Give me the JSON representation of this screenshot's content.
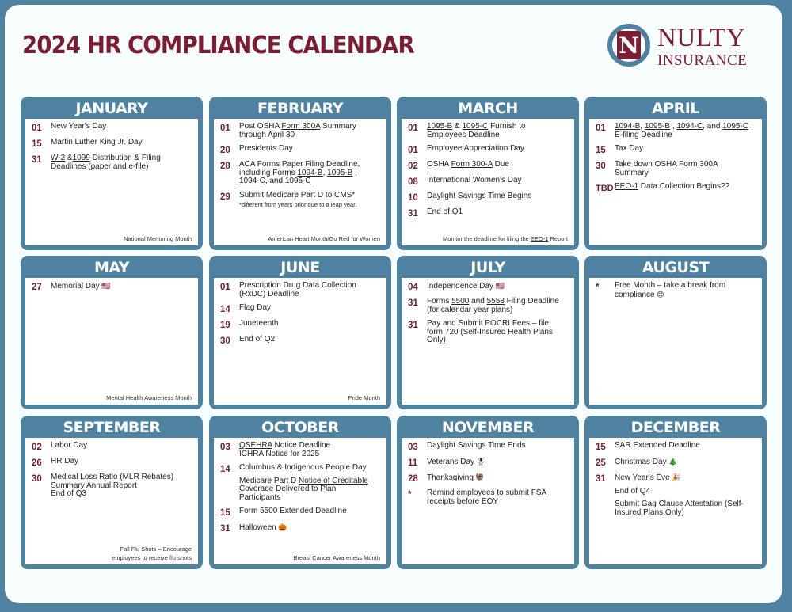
{
  "title": "2024 HR COMPLIANCE CALENDAR",
  "logo": {
    "name": "NULTY",
    "subtitle": "INSURANCE",
    "mark": "N"
  },
  "colors": {
    "brand_red": "#7a1f33",
    "brand_blue": "#4f82a0",
    "day_number": "#6b1f2e"
  },
  "months": [
    {
      "name": "JANUARY",
      "events": [
        {
          "day": "01",
          "lines": [
            "New Year's Day"
          ]
        },
        {
          "day": "15",
          "lines": [
            "Martin Luther King Jr. Day"
          ]
        },
        {
          "day": "31",
          "lines": [
            "W-2 &1099 Distribution & Filing",
            "Deadlines (paper and e-file)"
          ],
          "underlined": [
            "W-2",
            "1099"
          ]
        }
      ],
      "footer": [
        "National Mentoring Month"
      ]
    },
    {
      "name": "FEBRUARY",
      "events": [
        {
          "day": "01",
          "lines": [
            "Post OSHA Form 300A Summary",
            "through April 30"
          ],
          "underlined": [
            "Form 300A"
          ]
        },
        {
          "day": "20",
          "lines": [
            "Presidents Day"
          ]
        },
        {
          "day": "28",
          "lines": [
            "ACA Forms Paper Filing Deadline,",
            "including Forms 1094-B, 1095-B ,",
            "1094-C, and 1095-C"
          ],
          "underlined": [
            "1094-B",
            "1095-B",
            "1094-C",
            "1095-C"
          ]
        },
        {
          "day": "29",
          "lines": [
            "Submit Medicare Part D to CMS*"
          ],
          "note": "*different from years prior due to a leap year."
        }
      ],
      "footer": [
        "American Heart Month/Go Red for Women"
      ]
    },
    {
      "name": "MARCH",
      "events": [
        {
          "day": "01",
          "lines": [
            "1095-B & 1095-C Furnish to",
            "Employees Deadline"
          ],
          "underlined": [
            "1095-B",
            "1095-C"
          ]
        },
        {
          "day": "01",
          "lines": [
            "Employee Appreciation Day"
          ]
        },
        {
          "day": "02",
          "lines": [
            "OSHA Form 300-A Due"
          ],
          "underlined": [
            "Form 300-A"
          ]
        },
        {
          "day": "08",
          "lines": [
            "International Women's Day"
          ]
        },
        {
          "day": "10",
          "lines": [
            "Daylight Savings Time Begins"
          ]
        },
        {
          "day": "31",
          "lines": [
            "End of Q1"
          ]
        }
      ],
      "footer": [
        "Monitor the deadline for filing the EEO-1 Report"
      ]
    },
    {
      "name": "APRIL",
      "events": [
        {
          "day": "01",
          "lines": [
            "1094-B, 1095-B , 1094-C, and 1095-C",
            "E-filing Deadline"
          ],
          "underlined": [
            "1094-B",
            "1095-B",
            "1094-C",
            "1095-C"
          ]
        },
        {
          "day": "15",
          "lines": [
            "Tax Day"
          ]
        },
        {
          "day": "30",
          "lines": [
            "Take down OSHA Form 300A",
            "Summary"
          ]
        },
        {
          "day": "TBD",
          "lines": [
            "EEO-1 Data Collection Begins??"
          ],
          "underlined": [
            "EEO-1"
          ]
        }
      ],
      "footer": []
    },
    {
      "name": "MAY",
      "events": [
        {
          "day": "27",
          "lines": [
            "Memorial Day"
          ],
          "emoji": "🇺🇸"
        }
      ],
      "footer": [
        "Mental Health Awareness Month"
      ]
    },
    {
      "name": "JUNE",
      "events": [
        {
          "day": "01",
          "lines": [
            "Prescription Drug Data Collection",
            "(RxDC) Deadline"
          ]
        },
        {
          "day": "14",
          "lines": [
            "Flag Day"
          ]
        },
        {
          "day": "19",
          "lines": [
            "Juneteenth"
          ]
        },
        {
          "day": "30",
          "lines": [
            "End of Q2"
          ]
        }
      ],
      "footer": [
        "Pride Month"
      ]
    },
    {
      "name": "JULY",
      "events": [
        {
          "day": "04",
          "lines": [
            "Independence Day"
          ],
          "emoji": "🇺🇸"
        },
        {
          "day": "31",
          "lines": [
            "Forms 5500 and 5558 Filing Deadline",
            "(for calendar year plans)"
          ],
          "underlined": [
            "5500",
            "5558"
          ]
        },
        {
          "day": "31",
          "lines": [
            "Pay and Submit POCRI Fees – file",
            "form 720 (Self-Insured Health Plans",
            "Only)"
          ]
        }
      ],
      "footer": []
    },
    {
      "name": "AUGUST",
      "events": [
        {
          "day": "*",
          "lines": [
            "Free Month – take a break from",
            "compliance"
          ],
          "emoji": "😊"
        }
      ],
      "footer": []
    },
    {
      "name": "SEPTEMBER",
      "events": [
        {
          "day": "02",
          "lines": [
            "Labor Day"
          ]
        },
        {
          "day": "26",
          "lines": [
            "HR Day"
          ]
        },
        {
          "day": "30",
          "lines": [
            "Medical Loss Ratio (MLR Rebates)",
            "Summary Annual Report",
            "End of Q3"
          ]
        }
      ],
      "footer": [
        "Fall Flu Shots – Encourage",
        "employees to receive flu shots"
      ]
    },
    {
      "name": "OCTOBER",
      "events": [
        {
          "day": "03",
          "lines": [
            "QSEHRA Notice Deadline",
            "ICHRA Notice for 2025"
          ],
          "underlined": [
            "QSEHRA"
          ]
        },
        {
          "day": "14",
          "lines": [
            "Columbus & Indigenous People Day"
          ],
          "extra": [
            "Medicare Part D Notice of Creditable",
            "Coverage Delivered to Plan",
            "Participants"
          ],
          "underlined": [
            "Notice of Creditable",
            "Coverage"
          ]
        },
        {
          "day": "15",
          "lines": [
            "Form 5500 Extended Deadline"
          ]
        },
        {
          "day": "31",
          "lines": [
            "Halloween"
          ],
          "emoji": "🎃"
        }
      ],
      "footer": [
        "Breast Cancer Awareness Month"
      ]
    },
    {
      "name": "NOVEMBER",
      "events": [
        {
          "day": "03",
          "lines": [
            "Daylight Savings Time Ends"
          ]
        },
        {
          "day": "11",
          "lines": [
            "Veterans Day"
          ],
          "emoji": "🎖"
        },
        {
          "day": "28",
          "lines": [
            "Thanksgiving"
          ],
          "emoji": "🦃"
        },
        {
          "day": "*",
          "lines": [
            "Remind employees to submit FSA",
            "receipts before EOY"
          ]
        }
      ],
      "footer": []
    },
    {
      "name": "DECEMBER",
      "events": [
        {
          "day": "15",
          "lines": [
            "SAR Extended Deadline"
          ]
        },
        {
          "day": "25",
          "lines": [
            "Christmas Day"
          ],
          "emoji": "🎄"
        },
        {
          "day": "31",
          "lines": [
            "New Year's Eve"
          ],
          "emoji": "🎉",
          "extra": [
            "End of Q4"
          ],
          "extra2": [
            "Submit Gag Clause Attestation (Self-",
            "Insured Plans Only)"
          ]
        }
      ],
      "footer": []
    }
  ]
}
